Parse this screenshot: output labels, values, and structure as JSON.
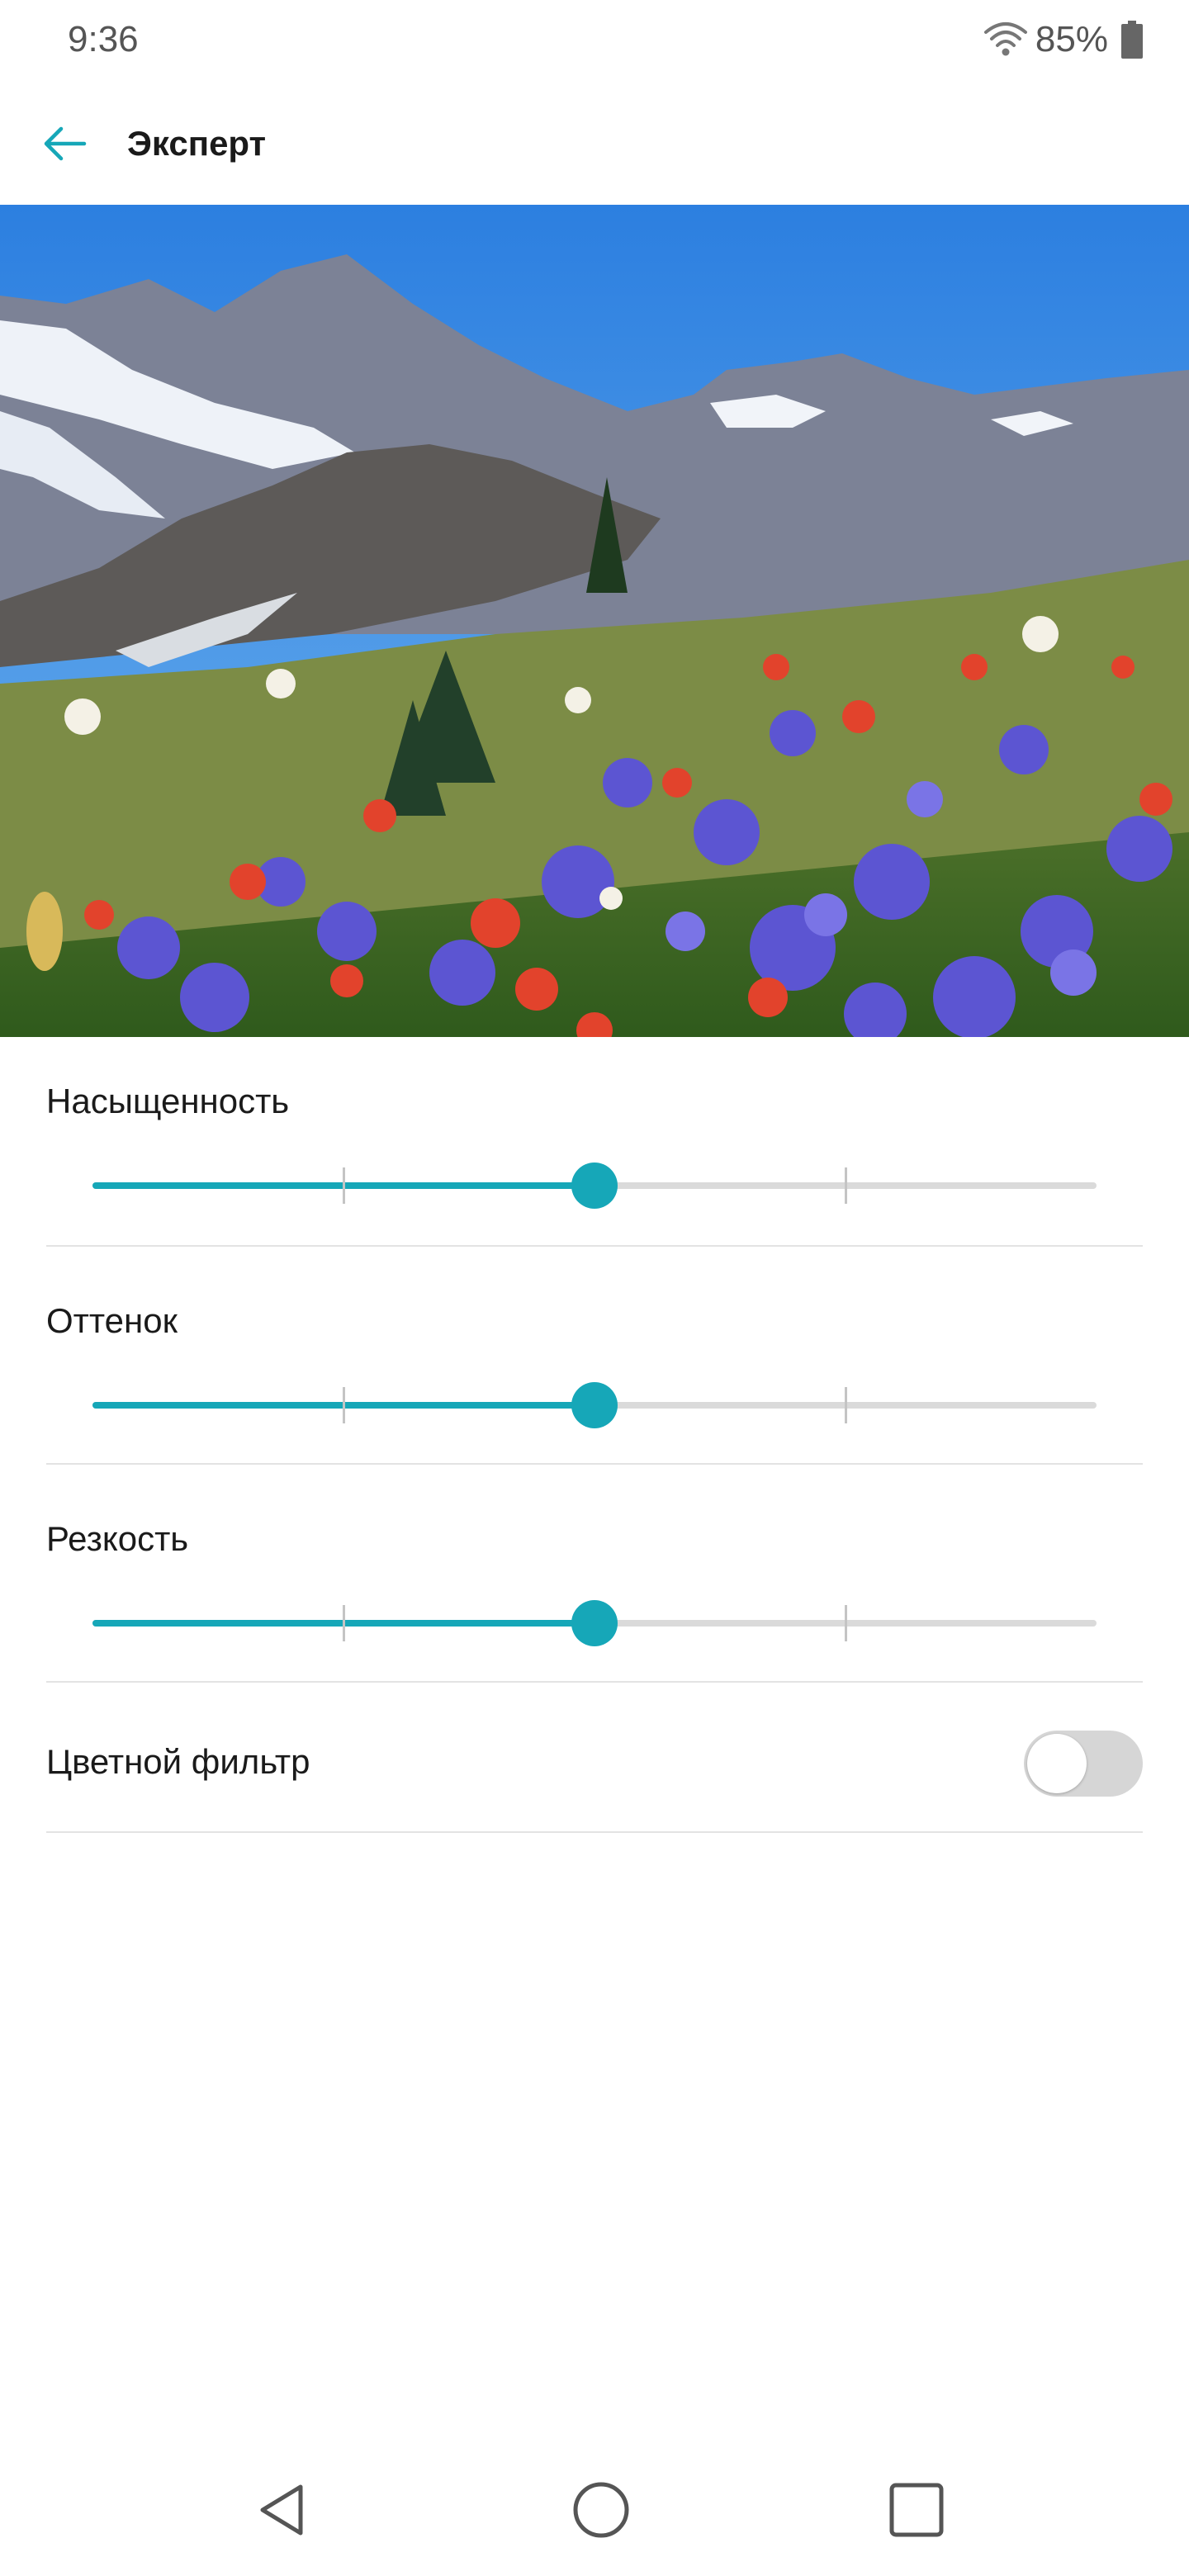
{
  "status_bar": {
    "time": "9:36",
    "battery_text": "85%",
    "icons": [
      "wifi-icon",
      "battery-icon"
    ]
  },
  "app_bar": {
    "title": "Эксперт",
    "back_icon": "arrow-left-icon",
    "accent_color": "#16a7b8"
  },
  "preview_image": {
    "icon": "landscape-photo",
    "description_tag": "mountain-wildflower-meadow"
  },
  "settings": {
    "saturation": {
      "label": "Насыщенность",
      "value": 0.5
    },
    "hue": {
      "label": "Оттенок",
      "value": 0.5
    },
    "sharpness": {
      "label": "Резкость",
      "value": 0.5
    },
    "color_filter": {
      "label": "Цветной фильтр",
      "enabled": false
    }
  },
  "slider_ticks": [
    0.25,
    0.5,
    0.75
  ],
  "nav_bar": {
    "icons": [
      "back-triangle-icon",
      "home-circle-icon",
      "recents-square-icon"
    ]
  },
  "colors": {
    "accent": "#16a7b8",
    "track": "#dadada",
    "toggle_off": "#d6d6d6"
  }
}
